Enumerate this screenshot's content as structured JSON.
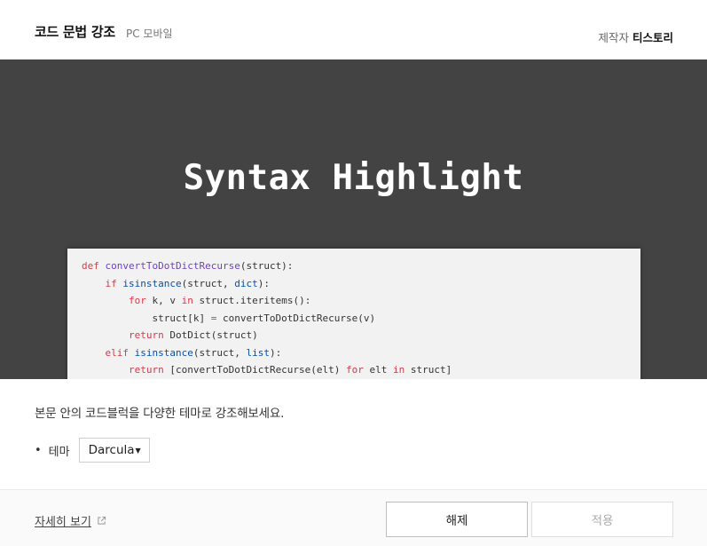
{
  "header": {
    "title": "코드 문법 강조",
    "platforms": "PC 모바일",
    "author_label": "제작자",
    "author_name": "티스토리"
  },
  "banner": {
    "title": "Syntax Highlight",
    "code_lines": [
      "def convertToDotDictRecurse(struct):",
      "    if isinstance(struct, dict):",
      "        for k, v in struct.iteritems():",
      "            struct[k] = convertToDotDictRecurse(v)",
      "        return DotDict(struct)",
      "    elif isinstance(struct, list):",
      "        return [convertToDotDictRecurse(elt) for elt in struct]"
    ]
  },
  "content": {
    "description": "본문 안의 코드블럭을 다양한 테마로 강조해보세요.",
    "option_label": "테마",
    "theme_selected": "Darcula"
  },
  "footer": {
    "detail_link": "자세히 보기",
    "release_button": "해제",
    "apply_button": "적용"
  },
  "icons": {
    "external": "external-link-icon",
    "caret": "caret-down-icon"
  }
}
